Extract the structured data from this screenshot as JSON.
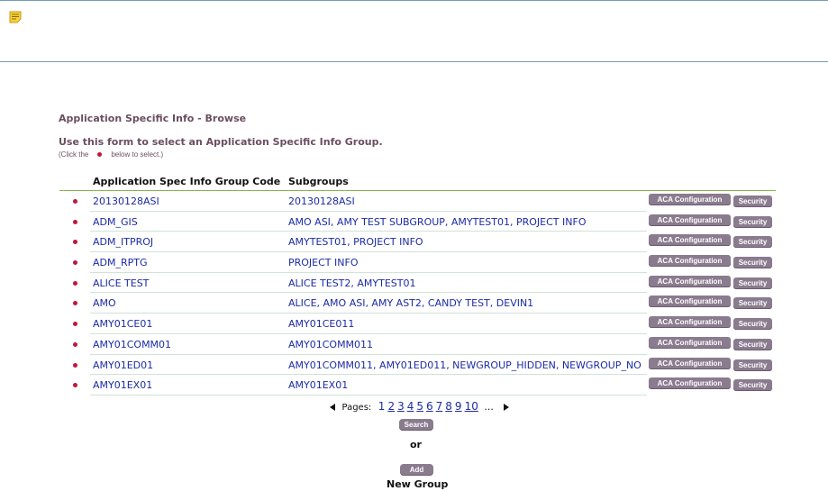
{
  "notice": {
    "icon": "note-icon"
  },
  "page": {
    "title": "Application Specific Info - Browse",
    "instructions": "Use this form to select an Application Specific Info Group.",
    "hint_prefix": "(Click the",
    "hint_suffix": "below to select.)"
  },
  "table": {
    "headers": {
      "code": "Application Spec Info Group Code",
      "subgroups": "Subgroups"
    },
    "aca_label": "ACA Configuration",
    "security_label": "Security",
    "rows": [
      {
        "code": "20130128ASI",
        "subgroups": "20130128ASI"
      },
      {
        "code": "ADM_GIS",
        "subgroups": "AMO ASI, AMY TEST SUBGROUP, AMYTEST01, PROJECT INFO"
      },
      {
        "code": "ADM_ITPROJ",
        "subgroups": "AMYTEST01, PROJECT INFO"
      },
      {
        "code": "ADM_RPTG",
        "subgroups": "PROJECT INFO"
      },
      {
        "code": "ALICE TEST",
        "subgroups": "ALICE TEST2, AMYTEST01"
      },
      {
        "code": "AMO",
        "subgroups": "ALICE, AMO ASI, AMY AST2, CANDY TEST, DEVIN1"
      },
      {
        "code": "AMY01CE01",
        "subgroups": "AMY01CE011"
      },
      {
        "code": "AMY01COMM01",
        "subgroups": "AMY01COMM011"
      },
      {
        "code": "AMY01ED01",
        "subgroups": "AMY01COMM011, AMY01ED011, NEWGROUP_HIDDEN, NEWGROUP_NO"
      },
      {
        "code": "AMY01EX01",
        "subgroups": "AMY01EX01"
      }
    ]
  },
  "pager": {
    "label": "Pages:",
    "pages": [
      "1",
      "2",
      "3",
      "4",
      "5",
      "6",
      "7",
      "8",
      "9",
      "10"
    ],
    "current": "1",
    "ellipsis": "..."
  },
  "actions": {
    "search_label": "Search",
    "or_label": "or",
    "add_label": "Add",
    "new_group_label": "New Group"
  },
  "colors": {
    "link": "#1b2ba6",
    "title": "#6b4e60",
    "dot": "#c0163c",
    "button": "#8a7b8e",
    "header_rule": "#89b44d"
  }
}
